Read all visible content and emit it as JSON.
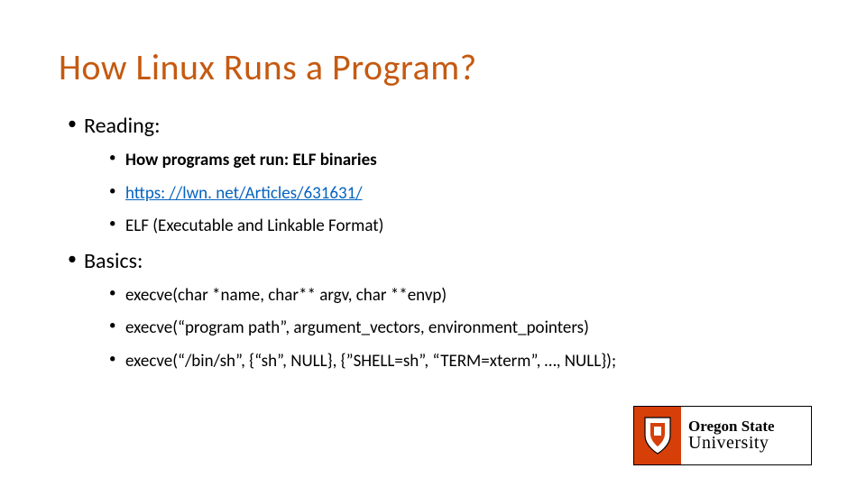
{
  "title": "How Linux Runs a Program?",
  "sections": [
    {
      "label": "Reading:",
      "items": [
        {
          "text": "How programs get run: ELF binaries",
          "bold": true,
          "link": false
        },
        {
          "text": "https: //lwn. net/Articles/631631/",
          "bold": false,
          "link": true
        },
        {
          "text": "ELF (Executable and Linkable Format)",
          "bold": false,
          "link": false
        }
      ]
    },
    {
      "label": "Basics:",
      "items": [
        {
          "text": "execve(char *name, char** argv, char **envp)",
          "bold": false,
          "link": false
        },
        {
          "text": "execve(“program path”, argument_vectors, environment_pointers)",
          "bold": false,
          "link": false
        },
        {
          "text": "execve(“/bin/sh”, {“sh”, NULL}, {”SHELL=sh”, “TERM=xterm”, …, NULL});",
          "bold": false,
          "link": false
        }
      ]
    }
  ],
  "logo": {
    "line1": "Oregon State",
    "line2": "University"
  }
}
